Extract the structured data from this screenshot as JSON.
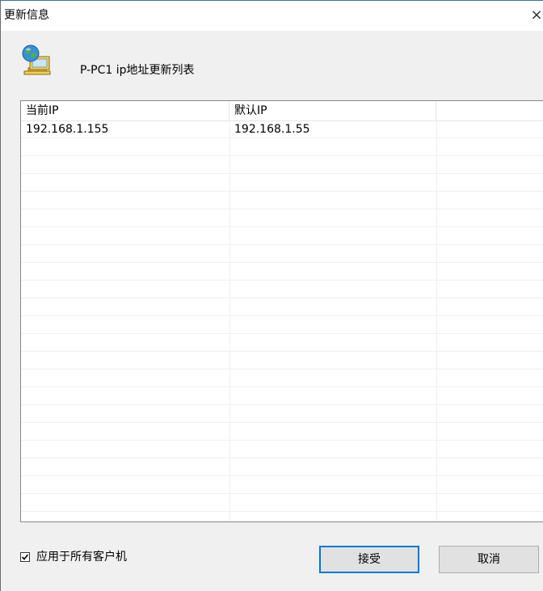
{
  "window": {
    "title": "更新信息",
    "close_glyph": "×"
  },
  "header": {
    "icon": "network-computer-icon",
    "title": "P-PC1 ip地址更新列表"
  },
  "list": {
    "columns": [
      "当前IP",
      "默认IP",
      ""
    ],
    "rows": [
      [
        "192.168.1.155",
        "192.168.1.55",
        ""
      ]
    ]
  },
  "footer": {
    "apply_all_label": "应用于所有客户机",
    "apply_all_checked": true,
    "accept_label": "接受",
    "cancel_label": "取消"
  },
  "colors": {
    "accent": "#0078d7",
    "window_bg": "#f0f0f0",
    "border": "#828790"
  }
}
